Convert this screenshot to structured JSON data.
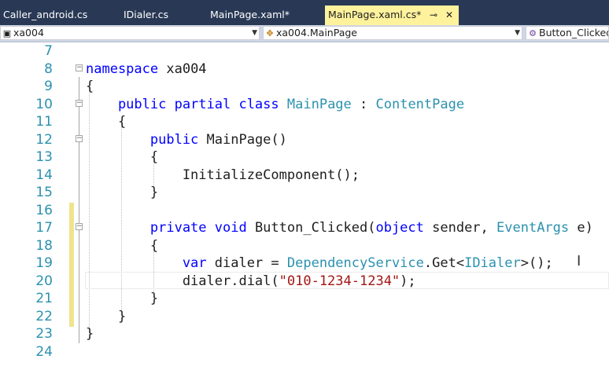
{
  "tabs": [
    {
      "label": "Caller_android.cs"
    },
    {
      "label": "IDialer.cs"
    },
    {
      "label": "MainPage.xaml*"
    },
    {
      "label": "MainPage.xaml.cs*",
      "pin": "⊸",
      "close": "✕"
    }
  ],
  "nav": {
    "project": "xa004",
    "type": "xa004.MainPage",
    "member": "Button_Clicked"
  },
  "lines": [
    {
      "n": "7"
    },
    {
      "n": "8"
    },
    {
      "n": "9"
    },
    {
      "n": "10"
    },
    {
      "n": "11"
    },
    {
      "n": "12"
    },
    {
      "n": "13"
    },
    {
      "n": "14"
    },
    {
      "n": "15"
    },
    {
      "n": "16"
    },
    {
      "n": "17"
    },
    {
      "n": "18"
    },
    {
      "n": "19"
    },
    {
      "n": "20"
    },
    {
      "n": "21"
    },
    {
      "n": "22"
    },
    {
      "n": "23"
    },
    {
      "n": "24"
    }
  ],
  "code": {
    "l8_kw": "namespace",
    "l8_name": " xa004",
    "l9": "{",
    "l10_kw": "    public partial class",
    "l10_cls": "MainPage",
    "l10_colon": " : ",
    "l10_base": "ContentPage",
    "l11": "    {",
    "l12_kw": "        public",
    "l12_rest": " MainPage()",
    "l13": "        {",
    "l14": "            InitializeComponent();",
    "l15": "        }",
    "l17_kw": "        private void",
    "l17_name": " Button_Clicked(",
    "l17_obj": "object",
    "l17_sender": " sender, ",
    "l17_args": "EventArgs",
    "l17_end": " e)",
    "l18": "        {",
    "l19_kw": "            var",
    "l19_mid": " dialer = ",
    "l19_ds": "DependencyService",
    "l19_get": ".Get<",
    "l19_if": "IDialer",
    "l19_end": ">();",
    "l20_pre": "            dialer.dial(",
    "l20_str": "\"010-1234-1234\"",
    "l20_end": ");",
    "l21": "        }",
    "l22": "    }",
    "l23": "}"
  },
  "colors": {
    "keyword": "#0000ff",
    "type": "#2b91af",
    "string": "#a31515",
    "line_number": "#2b91af",
    "active_tab": "#fff29d",
    "tab_strip": "#293955"
  }
}
